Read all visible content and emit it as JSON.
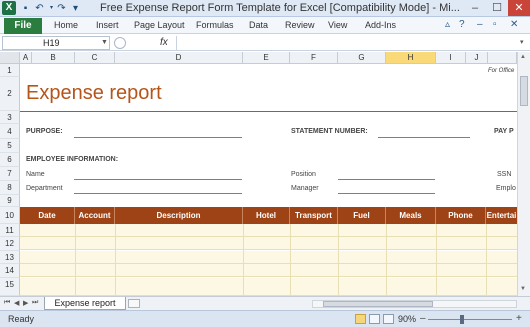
{
  "window": {
    "title": "Free Expense Report Form Template for Excel  [Compatibility Mode]  -  Mi...",
    "app_icon_label": "X",
    "minimize": "–",
    "maximize": "☐",
    "close": "✕"
  },
  "ribbon": {
    "file_tab": "File",
    "tabs": [
      "Home",
      "Insert",
      "Page Layout",
      "Formulas",
      "Data",
      "Review",
      "View",
      "Add-Ins"
    ]
  },
  "formula_bar": {
    "name_box": "H19",
    "fx_label": "fx",
    "value": ""
  },
  "grid": {
    "columns": [
      "A",
      "B",
      "C",
      "D",
      "E",
      "F",
      "G",
      "H",
      "I",
      "J"
    ],
    "selected_column": "H",
    "rows": [
      "1",
      "2",
      "3",
      "4",
      "5",
      "6",
      "7",
      "8",
      "9",
      "10",
      "11",
      "12",
      "13",
      "14",
      "15"
    ]
  },
  "document": {
    "for_office": "For Office",
    "title": "Expense report",
    "purpose_label": "PURPOSE:",
    "statement_label": "STATEMENT NUMBER:",
    "pay_period_label": "PAY P",
    "employee_info_label": "EMPLOYEE INFORMATION:",
    "name_label": "Name",
    "department_label": "Department",
    "position_label": "Position",
    "manager_label": "Manager",
    "ssn_label": "SSN",
    "employee_id_label": "Emplo",
    "table_headers": [
      "Date",
      "Account",
      "Description",
      "Hotel",
      "Transport",
      "Fuel",
      "Meals",
      "Phone",
      "Entertai"
    ]
  },
  "sheet_tabs": {
    "active": "Expense report"
  },
  "status_bar": {
    "status": "Ready",
    "zoom": "90%",
    "zoom_minus": "–",
    "zoom_plus": "+"
  },
  "colors": {
    "accent": "#9e4316",
    "title": "#b5551a",
    "row_fill": "#fdf8e4",
    "file_tab": "#2a7d3f"
  }
}
